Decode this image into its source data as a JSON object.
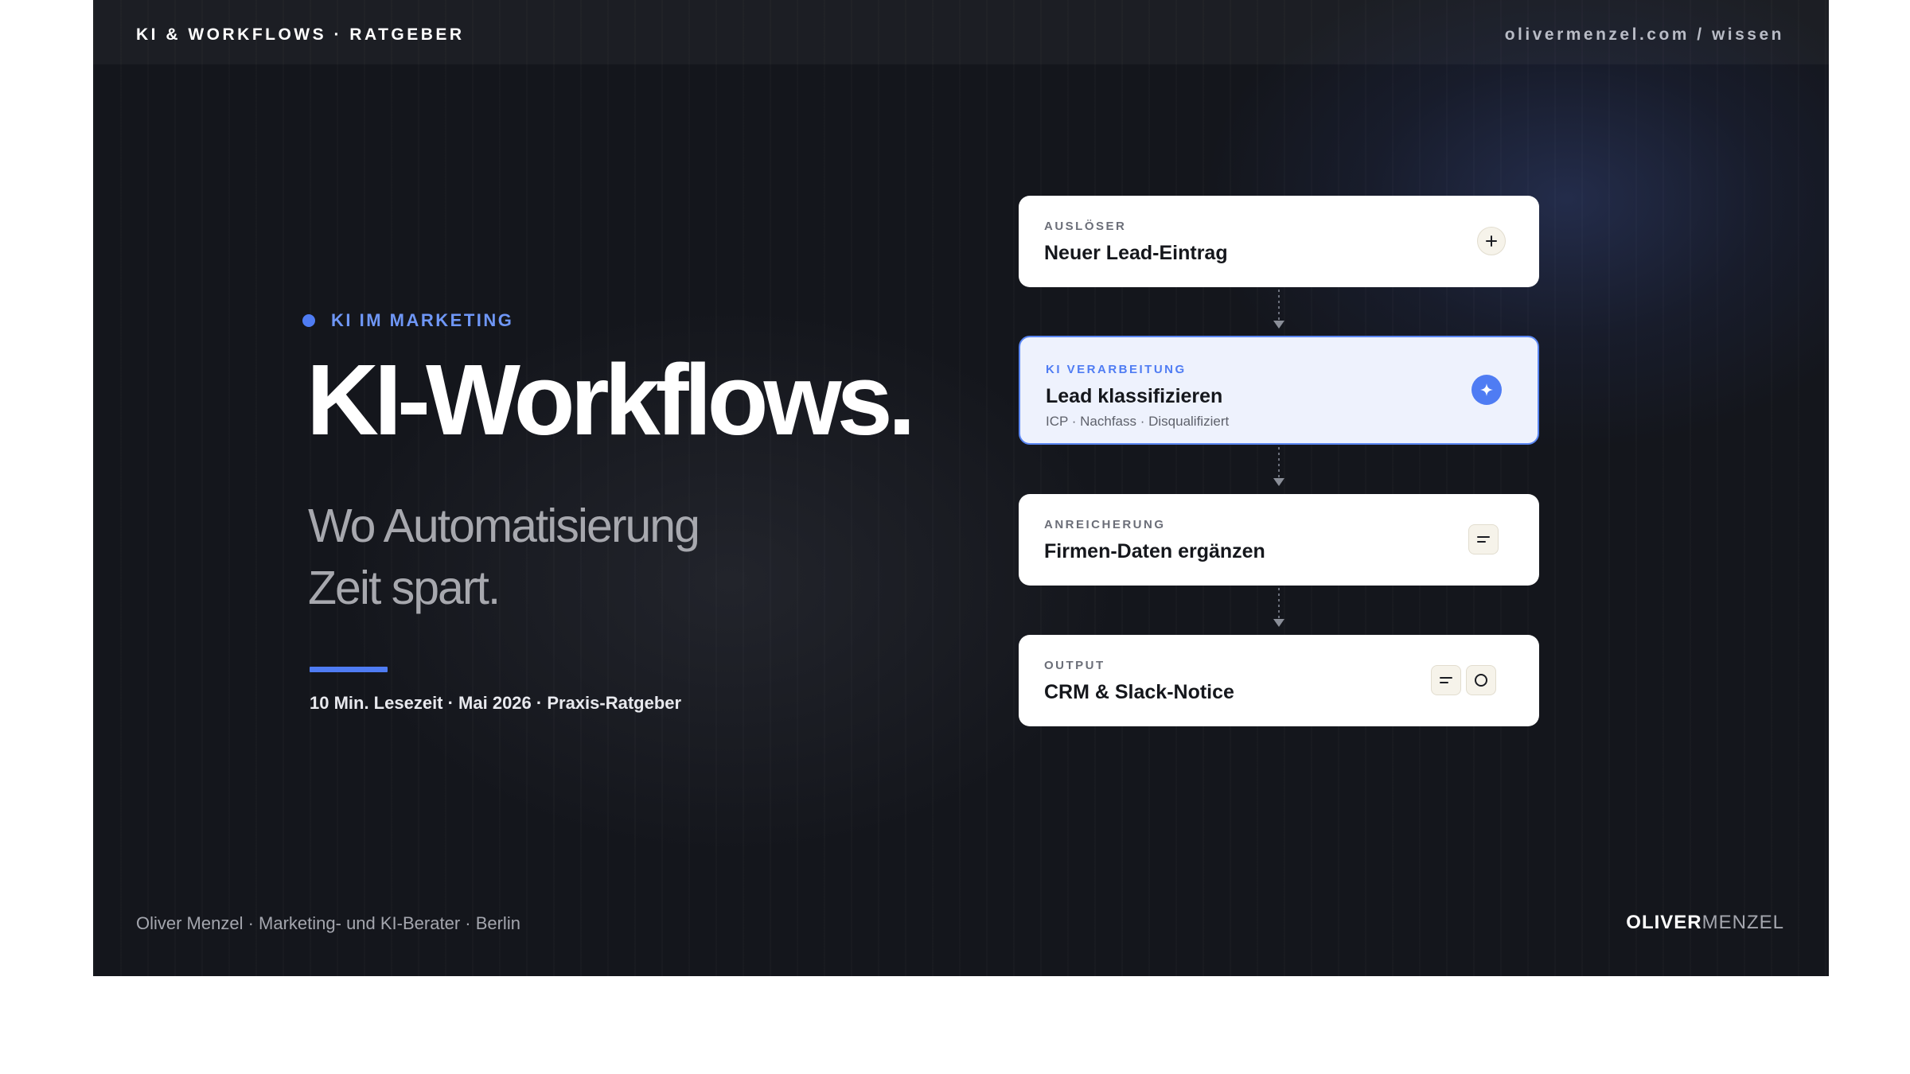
{
  "topbar": {
    "left": "KI & WORKFLOWS · RATGEBER",
    "right": "olivermenzel.com / wissen"
  },
  "hero": {
    "eyebrow": "KI IM MARKETING",
    "title": "KI-Workflows.",
    "subtitle_line1": "Wo Automatisierung",
    "subtitle_line2": "Zeit spart.",
    "meta": "10 Min. Lesezeit · Mai 2026 · Praxis-Ratgeber"
  },
  "footer": {
    "left": "Oliver Menzel · Marketing- und KI-Berater · Berlin",
    "logo_bold": "OLIVER",
    "logo_light": "MENZEL"
  },
  "workflow": {
    "steps": [
      {
        "label": "AUSLÖSER",
        "title": "Neuer Lead-Eintrag",
        "icons": [
          "plus-icon"
        ]
      },
      {
        "label": "KI VERARBEITUNG",
        "title": "Lead klassifizieren",
        "subtitle": "ICP · Nachfass · Disqualifiziert",
        "icons": [
          "sparkle-icon"
        ],
        "highlighted": true
      },
      {
        "label": "ANREICHERUNG",
        "title": "Firmen-Daten ergänzen",
        "icons": [
          "lines-icon"
        ]
      },
      {
        "label": "OUTPUT",
        "title": "CRM & Slack-Notice",
        "icons": [
          "lines-icon",
          "circle-icon"
        ]
      }
    ]
  },
  "colors": {
    "background": "#14161c",
    "accent": "#4f7cf3",
    "accent_text": "#6f97f7",
    "card": "#ffffff",
    "card_highlight": "#eef2fd"
  }
}
